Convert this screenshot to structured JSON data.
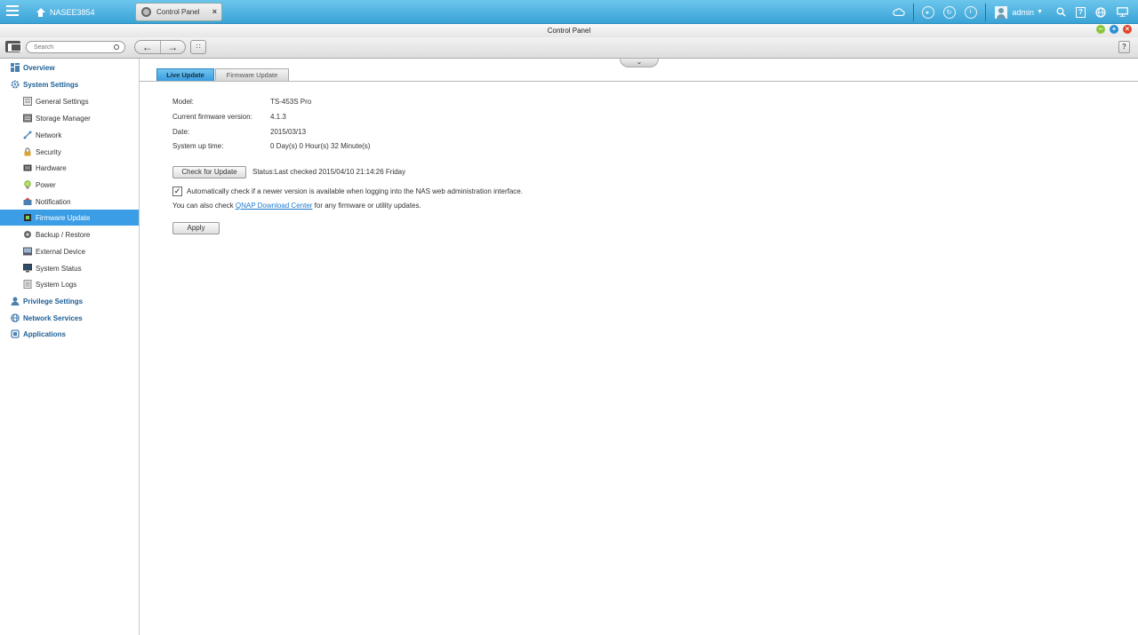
{
  "topbar": {
    "nas_name": "NASEE3854",
    "tab_title": "Control Panel",
    "tab_close": "×",
    "username": "admin",
    "help_glyph": "?"
  },
  "window": {
    "title": "Control Panel",
    "minimize": "–",
    "maximize": "+",
    "close": "×"
  },
  "toolbar": {
    "search_placeholder": "Search",
    "back": "←",
    "forward": "→",
    "apps_glyph": "∷",
    "help": "?"
  },
  "sidebar": {
    "items": [
      {
        "label": "Overview",
        "level": "top",
        "icon": "overview-icon"
      },
      {
        "label": "System Settings",
        "level": "top",
        "icon": "gear-icon"
      },
      {
        "label": "General Settings",
        "level": "sub",
        "icon": "general-settings-icon"
      },
      {
        "label": "Storage Manager",
        "level": "sub",
        "icon": "storage-icon"
      },
      {
        "label": "Network",
        "level": "sub",
        "icon": "network-icon"
      },
      {
        "label": "Security",
        "level": "sub",
        "icon": "lock-icon"
      },
      {
        "label": "Hardware",
        "level": "sub",
        "icon": "hardware-icon"
      },
      {
        "label": "Power",
        "level": "sub",
        "icon": "bulb-icon"
      },
      {
        "label": "Notification",
        "level": "sub",
        "icon": "notification-icon"
      },
      {
        "label": "Firmware Update",
        "level": "sub",
        "icon": "firmware-icon",
        "active": true
      },
      {
        "label": "Backup / Restore",
        "level": "sub",
        "icon": "backup-icon"
      },
      {
        "label": "External Device",
        "level": "sub",
        "icon": "external-device-icon"
      },
      {
        "label": "System Status",
        "level": "sub",
        "icon": "monitor-icon"
      },
      {
        "label": "System Logs",
        "level": "sub",
        "icon": "logs-icon"
      },
      {
        "label": "Privilege Settings",
        "level": "top",
        "icon": "user-icon"
      },
      {
        "label": "Network Services",
        "level": "top",
        "icon": "globe-icon"
      },
      {
        "label": "Applications",
        "level": "top",
        "icon": "applications-icon"
      }
    ]
  },
  "main": {
    "tabs": [
      {
        "label": "Live Update",
        "active": true
      },
      {
        "label": "Firmware Update",
        "active": false
      }
    ],
    "info": [
      {
        "label": "Model:",
        "value": "TS-453S Pro"
      },
      {
        "label": "Current firmware version:",
        "value": "4.1.3"
      },
      {
        "label": "Date:",
        "value": "2015/03/13"
      },
      {
        "label": "System up time:",
        "value": "0 Day(s) 0 Hour(s) 32 Minute(s)"
      }
    ],
    "check_button": "Check for Update",
    "status": "Status:Last checked 2015/04/10 21:14:26 Friday",
    "auto_check_checked": true,
    "auto_check_label": "Automatically check if a newer version is available when logging into the NAS web administration interface.",
    "also_prefix": "You can also check ",
    "also_link": "QNAP Download Center",
    "also_suffix": " for any firmware or utility updates.",
    "apply_button": "Apply",
    "collapse_glyph": "⌄"
  },
  "colors": {
    "accent": "#3a9de6",
    "topbar": "#4fb3e2",
    "link": "#1d7bd0"
  }
}
